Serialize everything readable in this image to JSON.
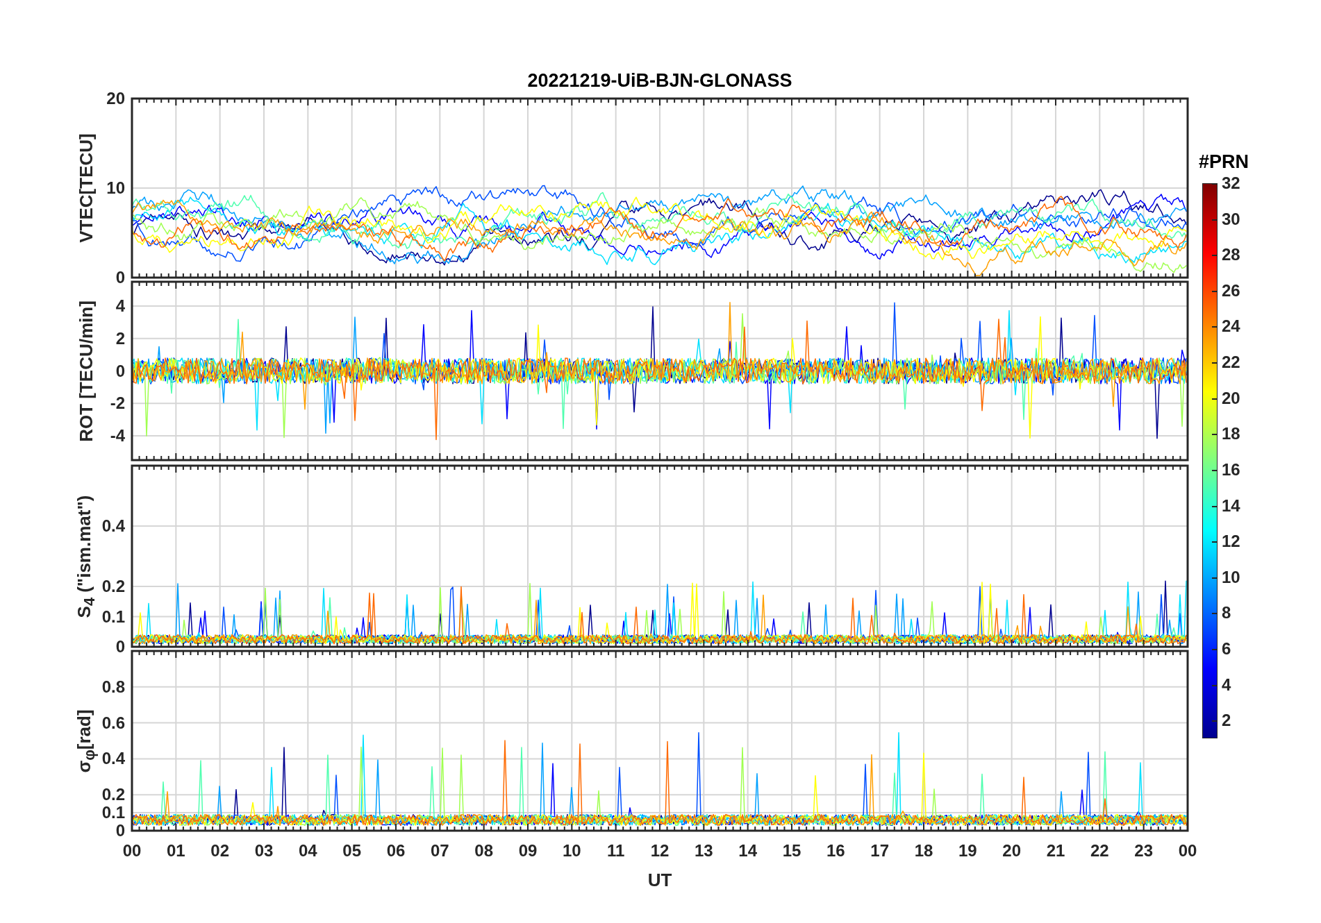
{
  "figure": {
    "title": "20221219-UiB-BJN-GLONASS",
    "xlabel": "UT",
    "xtick_labels": [
      "00",
      "01",
      "02",
      "03",
      "04",
      "05",
      "06",
      "07",
      "08",
      "09",
      "10",
      "11",
      "12",
      "13",
      "14",
      "15",
      "16",
      "17",
      "18",
      "19",
      "20",
      "21",
      "22",
      "23",
      "00"
    ],
    "panels": [
      {
        "kind": "vtec",
        "ylabel": "VTEC[TECU]",
        "yticks": [
          "20",
          "10",
          "0"
        ]
      },
      {
        "kind": "rot",
        "ylabel": "ROT [TECU/min]",
        "yticks": [
          "4",
          "2",
          "0",
          "-2",
          "-4"
        ]
      },
      {
        "kind": "s4",
        "ylabel": "S$_{4}$ (\"ism.mat\")",
        "yticks": [
          "0.4",
          "0.2",
          "0.1",
          "0"
        ]
      },
      {
        "kind": "sigma",
        "ylabel": "σ$_{φ}$[rad]",
        "yticks": [
          "0.8",
          "0.6",
          "0.4",
          "0.2",
          "0.1",
          "0"
        ]
      }
    ],
    "colorbar": {
      "title": "#PRN",
      "ticks": [
        "32",
        "30",
        "28",
        "26",
        "24",
        "22",
        "20",
        "18",
        "16",
        "14",
        "12",
        "10",
        "8",
        "6",
        "4",
        "2"
      ]
    }
  }
}
